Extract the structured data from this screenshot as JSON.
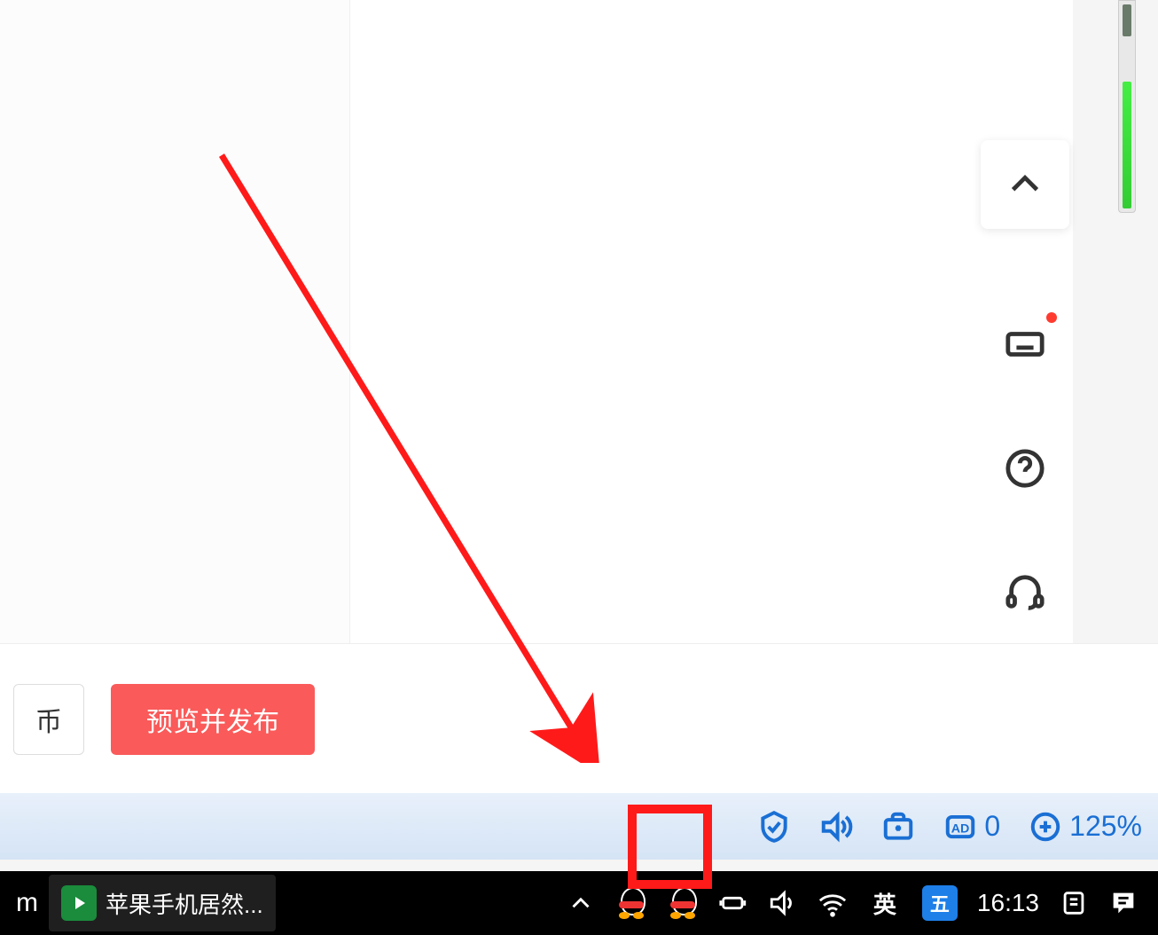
{
  "bottom_bar": {
    "secondary_button_fragment": "币",
    "publish_button": "预览并发布"
  },
  "side_toolbar": {
    "collapse_icon": "chevron-up",
    "keyboard_icon": "keyboard",
    "help_icon": "help",
    "headset_icon": "headset"
  },
  "browser_status": {
    "shield_icon": "shield",
    "sound_icon": "sound",
    "extension_icon": "extension",
    "ad_count": "0",
    "zoom_label": "125%"
  },
  "taskbar": {
    "left_text_fragment": "m",
    "app_title": "苹果手机居然...",
    "ime_lang": "英",
    "ime_method": "五",
    "clock": "16:13"
  }
}
